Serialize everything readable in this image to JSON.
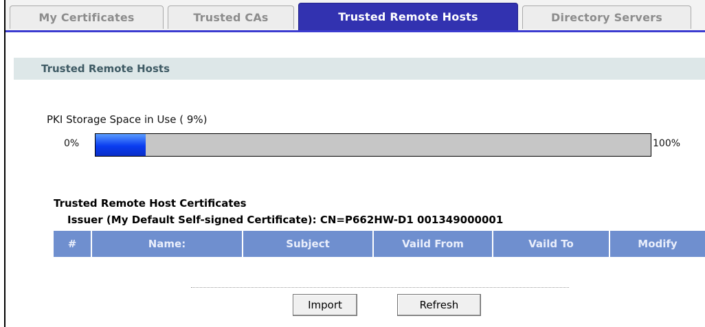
{
  "tabs": [
    {
      "label": "My Certificates",
      "active": false
    },
    {
      "label": "Trusted CAs",
      "active": false
    },
    {
      "label": "Trusted Remote Hosts",
      "active": true
    },
    {
      "label": "Directory Servers",
      "active": false
    }
  ],
  "section": {
    "title": "Trusted Remote Hosts"
  },
  "storage": {
    "label": "PKI Storage Space in Use ( 9%)",
    "min_label": "0%",
    "max_label": "100%",
    "percent_used": 9
  },
  "certificates": {
    "title": "Trusted Remote Host Certificates",
    "issuer": "Issuer (My Default Self-signed Certificate): CN=P662HW-D1 001349000001",
    "columns": [
      "#",
      "Name:",
      "Subject",
      "Vaild From",
      "Vaild To",
      "Modify"
    ]
  },
  "buttons": {
    "import": "Import",
    "refresh": "Refresh"
  },
  "colors": {
    "active_tab": "#3232b0",
    "table_header": "#6f8fcf",
    "section_header_bg": "#dde7e8",
    "bar_fill": "#0a3cf0"
  }
}
